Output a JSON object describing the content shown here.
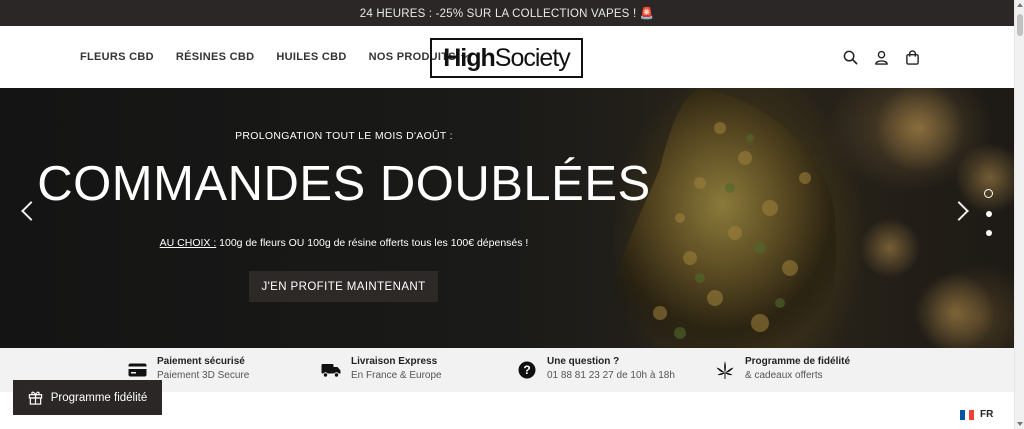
{
  "announcement": {
    "text": "24 HEURES : -25% SUR LA COLLECTION VAPES ! 🚨"
  },
  "nav": {
    "items": [
      {
        "label": "FLEURS CBD"
      },
      {
        "label": "RÉSINES CBD"
      },
      {
        "label": "HUILES CBD"
      },
      {
        "label": "NOS PRODUITS"
      }
    ],
    "logo": {
      "bold": "High",
      "light": "Society"
    },
    "icons": [
      "search-icon",
      "account-icon",
      "cart-icon"
    ]
  },
  "hero": {
    "subtitle": "PROLONGATION TOUT LE MOIS D'AOÛT :",
    "title": "COMMANDES DOUBLÉES",
    "desc_underline": "AU CHOIX :",
    "desc_rest": " 100g de fleurs OU 100g de résine offerts tous les 100€ dépensés !",
    "cta": "J'EN PROFITE MAINTENANT",
    "slides_total": 3,
    "active_slide": 1
  },
  "features": [
    {
      "title": "Paiement sécurisé",
      "subtitle": "Paiement 3D Secure",
      "icon": "credit-card-icon"
    },
    {
      "title": "Livraison Express",
      "subtitle": "En France & Europe",
      "icon": "truck-icon"
    },
    {
      "title": "Une question ?",
      "subtitle": "01 88 81 23 27 de 10h à 18h",
      "icon": "question-icon"
    },
    {
      "title": "Programme de fidélité",
      "subtitle": "& cadeaux offerts",
      "icon": "cannabis-leaf-icon"
    }
  ],
  "loyalty_button": {
    "label": "Programme fidélité",
    "icon": "gift-icon"
  },
  "language": {
    "code": "FR",
    "flag_colors": [
      "#0055a4",
      "#ffffff",
      "#ef4135"
    ]
  }
}
